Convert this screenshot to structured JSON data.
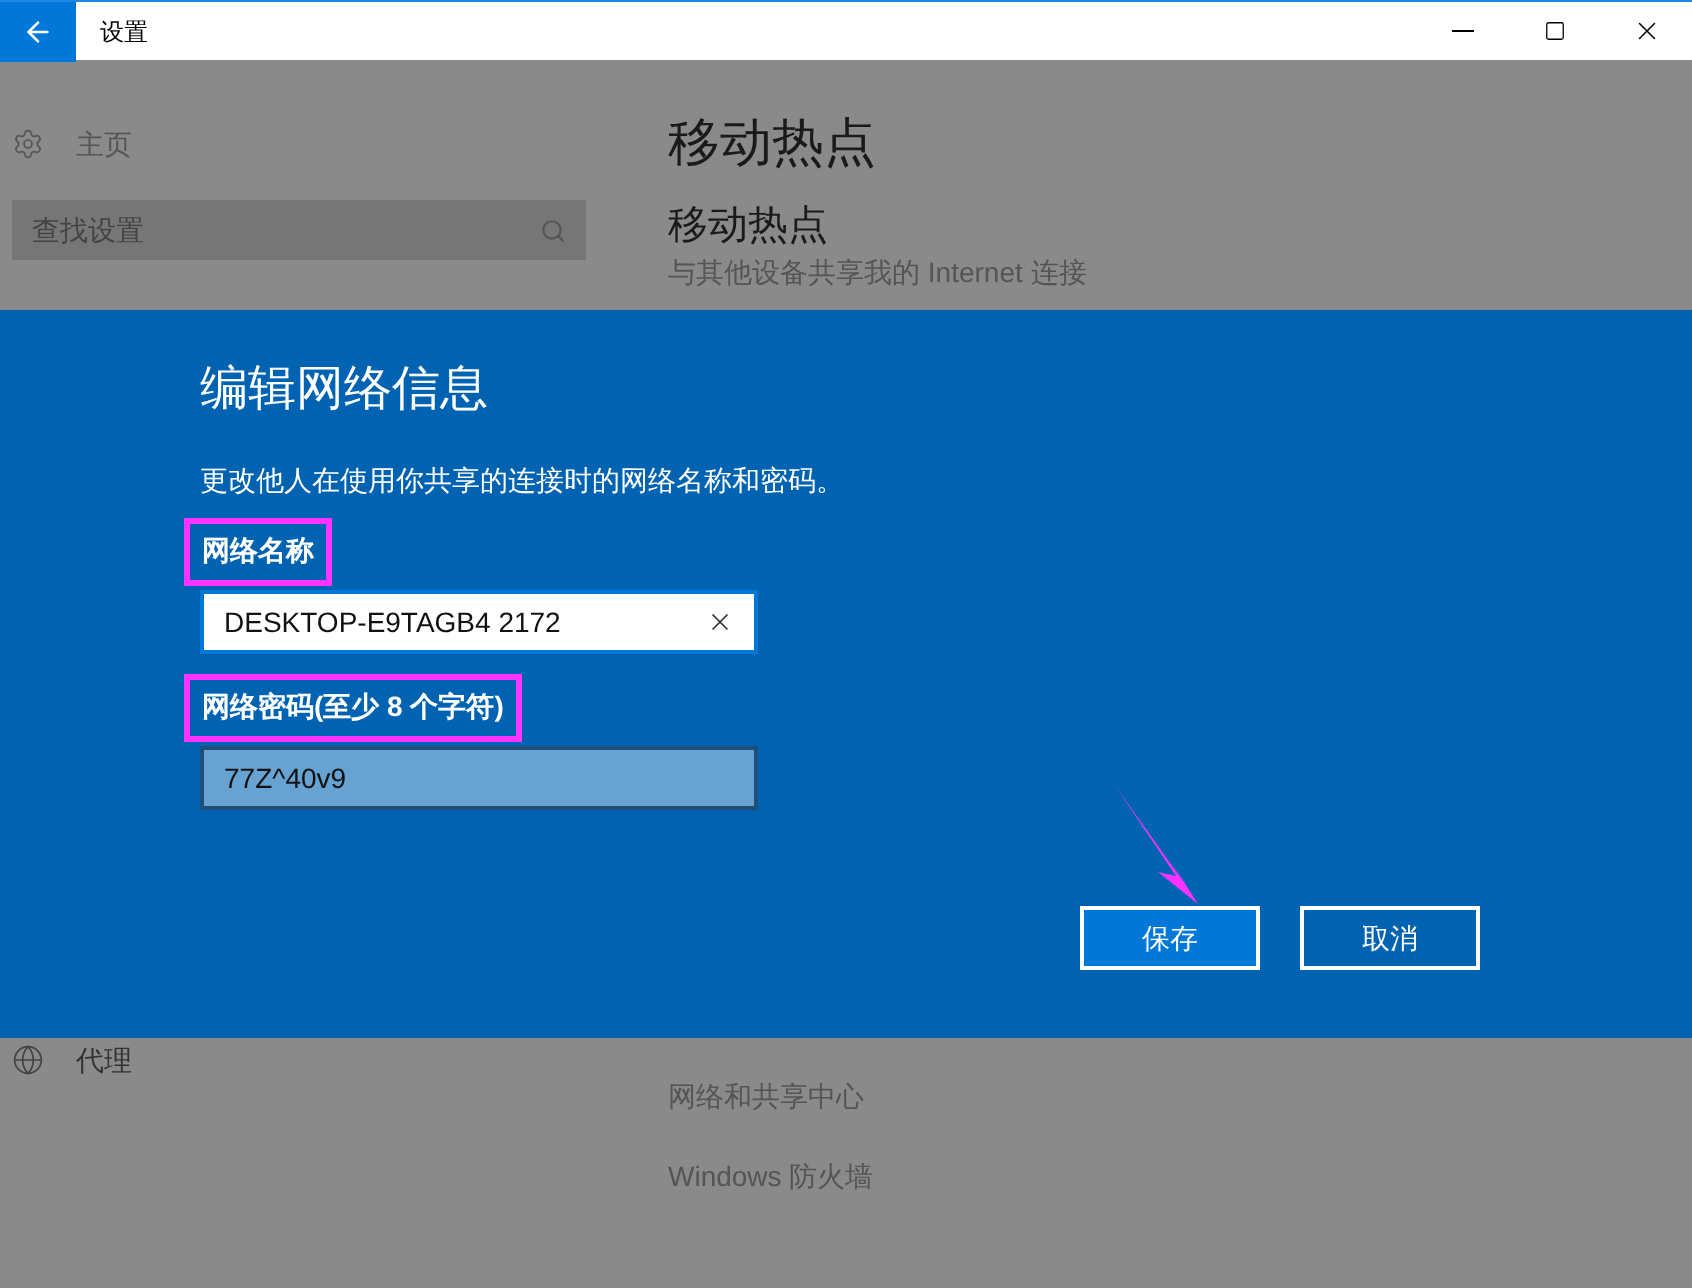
{
  "window": {
    "title": "设置"
  },
  "sidebar": {
    "home": "主页",
    "search": {
      "placeholder": "查找设置"
    },
    "items": [
      {
        "label": "代理"
      }
    ]
  },
  "main": {
    "title": "移动热点",
    "section_title": "移动热点",
    "section_description": "与其他设备共享我的 Internet 连接",
    "links": [
      "网络和共享中心",
      "Windows 防火墙"
    ]
  },
  "dialog": {
    "title": "编辑网络信息",
    "description": "更改他人在使用你共享的连接时的网络名称和密码。",
    "fields": [
      {
        "label": "网络名称",
        "value": "DESKTOP-E9TAGB4 2172",
        "focused": true,
        "highlighted": true
      },
      {
        "label": "网络密码(至少 8 个字符)",
        "value": "77Z^40v9",
        "focused": false,
        "highlighted": true
      }
    ],
    "buttons": [
      "保存",
      "取消"
    ]
  }
}
